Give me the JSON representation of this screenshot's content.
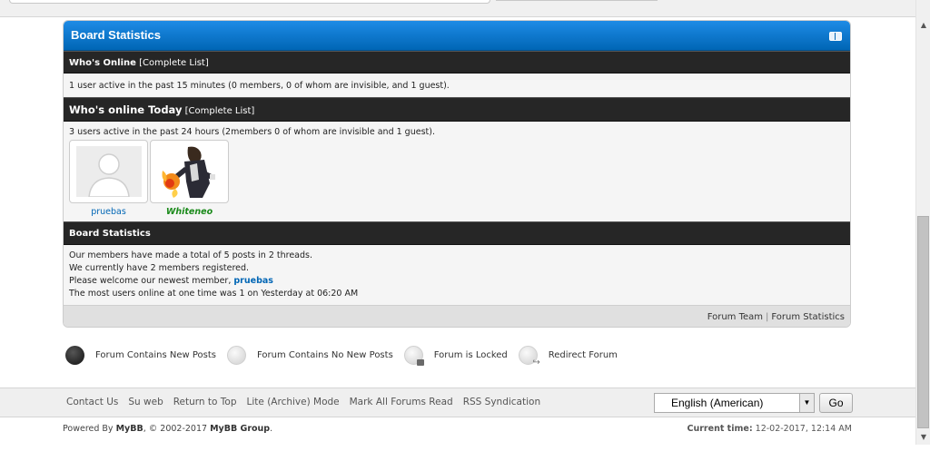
{
  "board": {
    "title": "Board Statistics",
    "whos_online": {
      "heading": "Who's Online",
      "complete_list": "[Complete List]",
      "text": "1 user active in the past 15 minutes (0 members, 0 of whom are invisible, and 1 guest)."
    },
    "online_today": {
      "heading": "Who's online Today",
      "complete_list": "[Complete List]",
      "text": "3 users active in the past 24 hours (2members 0 of whom are invisible and 1 guest).",
      "users": [
        {
          "name": "pruebas",
          "avatar": "default-avatar-icon"
        },
        {
          "name": "Whiteneo",
          "avatar": "character-avatar"
        }
      ]
    },
    "stats": {
      "heading": "Board Statistics",
      "line1": "Our members have made a total of 5 posts in 2 threads.",
      "line2": "We currently have 2 members registered.",
      "line3_prefix": "Please welcome our newest member, ",
      "newest_member": "pruebas",
      "line4": "The most users online at one time was 1 on Yesterday at 06:20 AM"
    },
    "footer_links": {
      "forum_team": "Forum Team",
      "separator": "|",
      "forum_statistics": "Forum Statistics"
    }
  },
  "legend": {
    "new_posts": "Forum Contains New Posts",
    "no_new_posts": "Forum Contains No New Posts",
    "locked": "Forum is Locked",
    "redirect": "Redirect Forum"
  },
  "bottom_menu": {
    "links": [
      "Contact Us",
      "Su web",
      "Return to Top",
      "Lite (Archive) Mode",
      "Mark All Forums Read",
      "RSS Syndication"
    ],
    "language": "English (American)",
    "go": "Go"
  },
  "copyright": {
    "prefix": "Powered By ",
    "mybb": "MyBB",
    "middle": ", © 2002-2017 ",
    "group": "MyBB Group",
    "suffix": "."
  },
  "current_time": {
    "label": "Current time:",
    "value": " 12-02-2017, 12:14 AM"
  },
  "colors": {
    "header_blue": "#0f78d0",
    "category_dark": "#262626",
    "link_blue": "#0066b5",
    "admin_green": "#1a8a1a"
  }
}
